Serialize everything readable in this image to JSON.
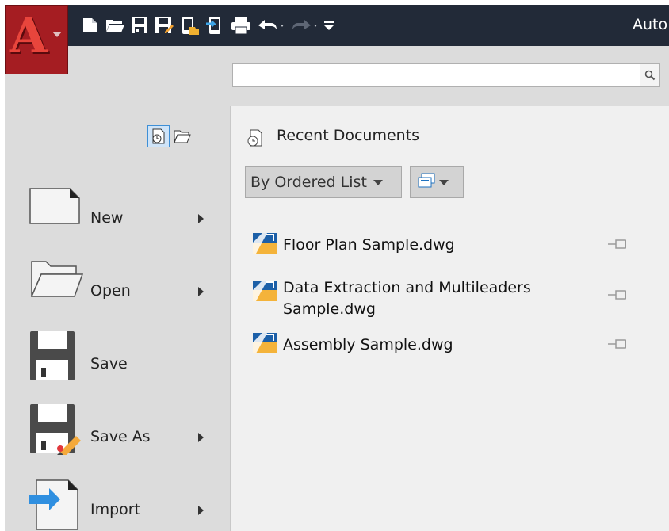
{
  "app": {
    "logo_letter": "A",
    "title_text": "Auto"
  },
  "quick_access": {
    "icons": [
      "new-icon",
      "open-icon",
      "save-icon",
      "saveas-icon",
      "open-web-icon",
      "save-web-icon",
      "plot-icon",
      "undo-icon",
      "redo-icon",
      "customize-icon"
    ]
  },
  "search": {
    "value": "",
    "placeholder": ""
  },
  "menu": {
    "items": [
      {
        "label": "New",
        "icon": "new-document-icon",
        "has_submenu": true
      },
      {
        "label": "Open",
        "icon": "open-folder-icon",
        "has_submenu": true
      },
      {
        "label": "Save",
        "icon": "save-icon",
        "has_submenu": false
      },
      {
        "label": "Save As",
        "icon": "save-as-icon",
        "has_submenu": true
      },
      {
        "label": "Import",
        "icon": "import-icon",
        "has_submenu": true
      }
    ]
  },
  "recent": {
    "title": "Recent Documents",
    "sort_label": "By Ordered List",
    "documents": [
      {
        "name": "Floor Plan Sample.dwg"
      },
      {
        "name": "Data Extraction and Multileaders Sample.dwg"
      },
      {
        "name": "Assembly Sample.dwg"
      }
    ]
  },
  "colors": {
    "topbar": "#222a38",
    "app_button": "#a51d22",
    "left_pane": "#dcdcdc",
    "right_pane": "#f0f0f0"
  }
}
